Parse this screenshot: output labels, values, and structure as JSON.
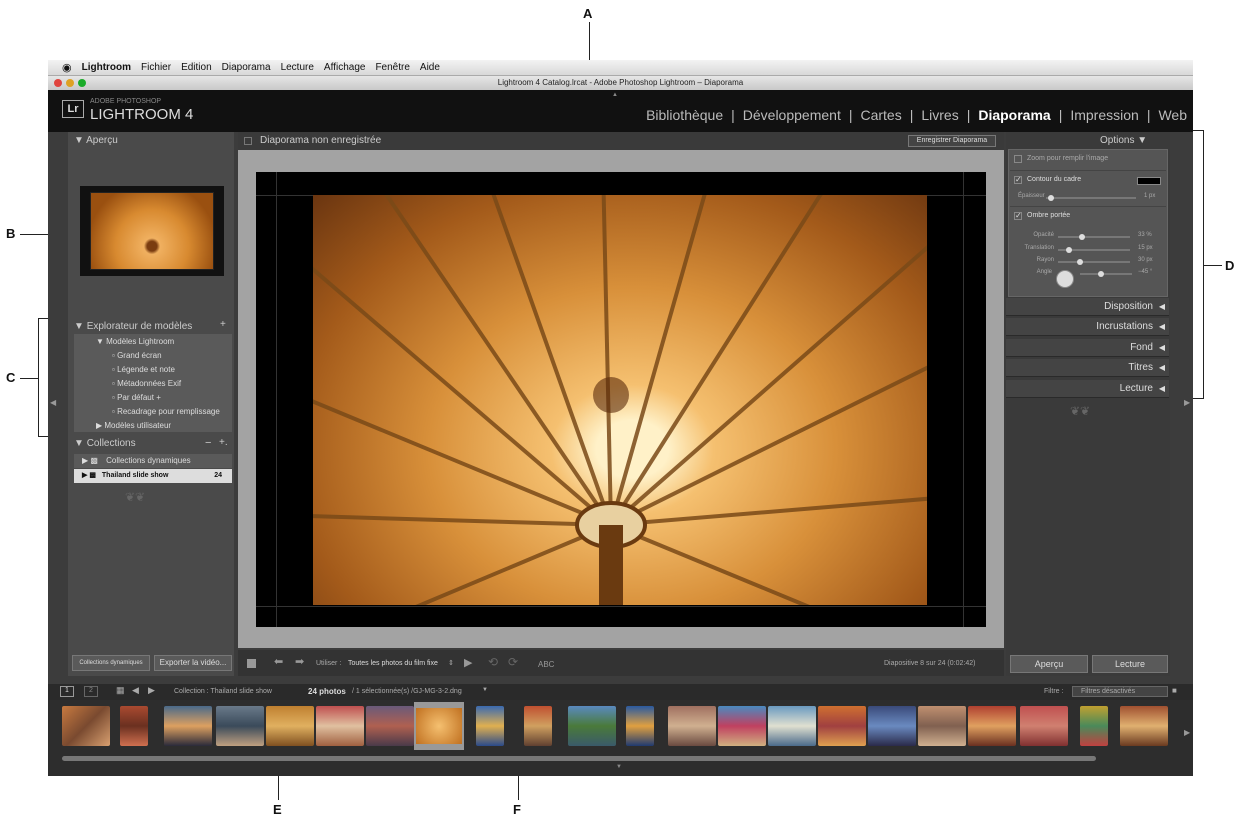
{
  "callouts": {
    "a": "A",
    "b": "B",
    "c": "C",
    "d": "D",
    "e": "E",
    "f": "F"
  },
  "menubar": {
    "apple": "",
    "items": [
      "Lightroom",
      "Fichier",
      "Edition",
      "Diaporama",
      "Lecture",
      "Affichage",
      "Fenêtre",
      "Aide"
    ]
  },
  "window": {
    "title": "Lightroom 4 Catalog.lrcat - Adobe Photoshop Lightroom – Diaporama"
  },
  "identity": {
    "badge": "Lr",
    "brand_small": "ADOBE PHOTOSHOP",
    "brand_big": "LIGHTROOM 4"
  },
  "modules": [
    "Bibliothèque",
    "Développement",
    "Cartes",
    "Livres",
    "Diaporama",
    "Impression",
    "Web"
  ],
  "module_separator": "|",
  "left": {
    "preview_header": "Aperçu",
    "templates_header": "Explorateur de modèles",
    "templates_folder": "Modèles Lightroom",
    "templates": [
      "Grand écran",
      "Légende et note",
      "Métadonnées Exif",
      "Par défaut +",
      "Recadrage pour remplissage"
    ],
    "user_templates": "Modèles utilisateur",
    "collections_header": "Collections",
    "collections_minus": "−",
    "collections_plus": "+.",
    "smart_collections": "Collections dynamiques",
    "collection_name": "Thailand slide show",
    "collection_count": "24",
    "btn_smart": "Collections dynamiques",
    "btn_export": "Exporter la vidéo..."
  },
  "center": {
    "unsaved_label": "Diaporama non enregistrée",
    "save_button": "Enregistrer Diaporama",
    "use_label": "Utiliser :",
    "use_value": "Toutes les photos du film fixe",
    "abc_label": "ABC",
    "slide_status": "Diapositive 8 sur 24 (0:02:42)"
  },
  "right": {
    "options_header": "Options",
    "zoom_label": "Zoom pour remplir l'image",
    "stroke_label": "Contour du cadre",
    "thickness_label": "Épaisseur",
    "thickness_value": "1 px",
    "shadow_label": "Ombre portée",
    "opacity_label": "Opacité",
    "opacity_value": "33 %",
    "offset_label": "Translation",
    "offset_value": "15 px",
    "radius_label": "Rayon",
    "radius_value": "30 px",
    "angle_label": "Angle",
    "angle_value": "−45 °",
    "sections": [
      "Disposition",
      "Incrustations",
      "Fond",
      "Titres",
      "Lecture"
    ],
    "preview_button": "Aperçu",
    "play_button": "Lecture"
  },
  "filmstrip": {
    "view1": "1",
    "view2": "2",
    "source": "Collection : Thailand slide show",
    "count": "24 photos",
    "selection": "/ 1 sélectionnée(s) /GJ-MG-3-2.dng",
    "filter_label": "Filtre :",
    "filter_value": "Filtres désactivés"
  },
  "sliders": {
    "thickness": 0.05,
    "opacity": 0.33,
    "offset": 0.15,
    "radius": 0.3,
    "angle": 0.4
  },
  "colors": {
    "accent_text": "#ffffff",
    "panel_bg": "#4a4a4a",
    "app_bg": "#3c3c3c",
    "photo_tone": "#d89040"
  }
}
